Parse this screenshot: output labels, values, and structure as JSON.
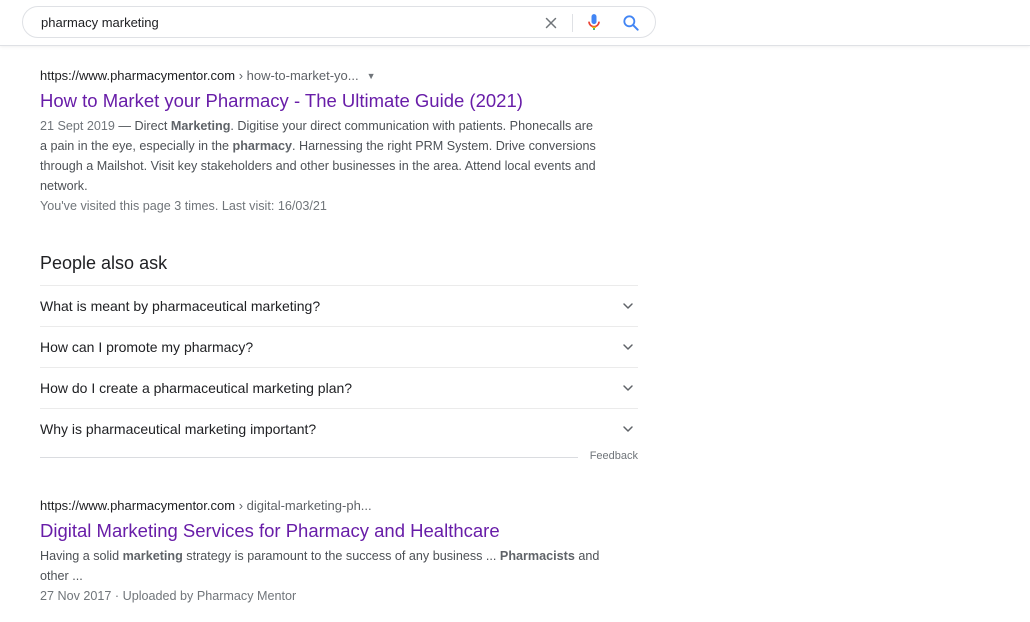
{
  "search": {
    "query": "pharmacy marketing",
    "clear_icon": "close-icon",
    "mic_icon": "microphone-icon",
    "search_icon": "search-icon"
  },
  "results": [
    {
      "domain": "https://www.pharmacymentor.com",
      "path": " › how-to-market-yo...",
      "has_caret": true,
      "title": "How to Market your Pharmacy - The Ultimate Guide (2021)",
      "date": "21 Sept 2019",
      "date_sep": " — ",
      "snippet_parts": [
        {
          "text": "Direct ",
          "bold": false
        },
        {
          "text": "Marketing",
          "bold": true
        },
        {
          "text": ". Digitise your direct communication with patients. Phonecalls are a pain in the eye, especially in the ",
          "bold": false
        },
        {
          "text": "pharmacy",
          "bold": true
        },
        {
          "text": ". Harnessing the right PRM System. Drive conversions through a Mailshot. Visit key stakeholders and other businesses in the area. Attend local events and network.",
          "bold": false
        }
      ],
      "visited": "You've visited this page 3 times. Last visit: 16/03/21"
    },
    {
      "domain": "https://www.pharmacymentor.com",
      "path": " › digital-marketing-ph...",
      "has_caret": false,
      "title": "Digital Marketing Services for Pharmacy and Healthcare",
      "snippet_parts": [
        {
          "text": "Having a solid ",
          "bold": false
        },
        {
          "text": "marketing",
          "bold": true
        },
        {
          "text": " strategy is paramount to the success of any business ... ",
          "bold": false
        },
        {
          "text": "Pharmacists",
          "bold": true
        },
        {
          "text": " and other ...",
          "bold": false
        }
      ],
      "meta": "27 Nov 2017 · Uploaded by Pharmacy Mentor"
    }
  ],
  "people_also_ask": {
    "heading": "People also ask",
    "questions": [
      "What is meant by pharmaceutical marketing?",
      "How can I promote my pharmacy?",
      "How do I create a pharmaceutical marketing plan?",
      "Why is pharmaceutical marketing important?"
    ],
    "chevron_icon": "chevron-down-icon",
    "feedback": "Feedback"
  },
  "colors": {
    "visited_link": "#681da8",
    "snippet_text": "#4d5156",
    "meta_text": "#70757a",
    "mic_blue": "#4285f4",
    "mic_red": "#ea4335",
    "search_blue": "#4285f4"
  }
}
